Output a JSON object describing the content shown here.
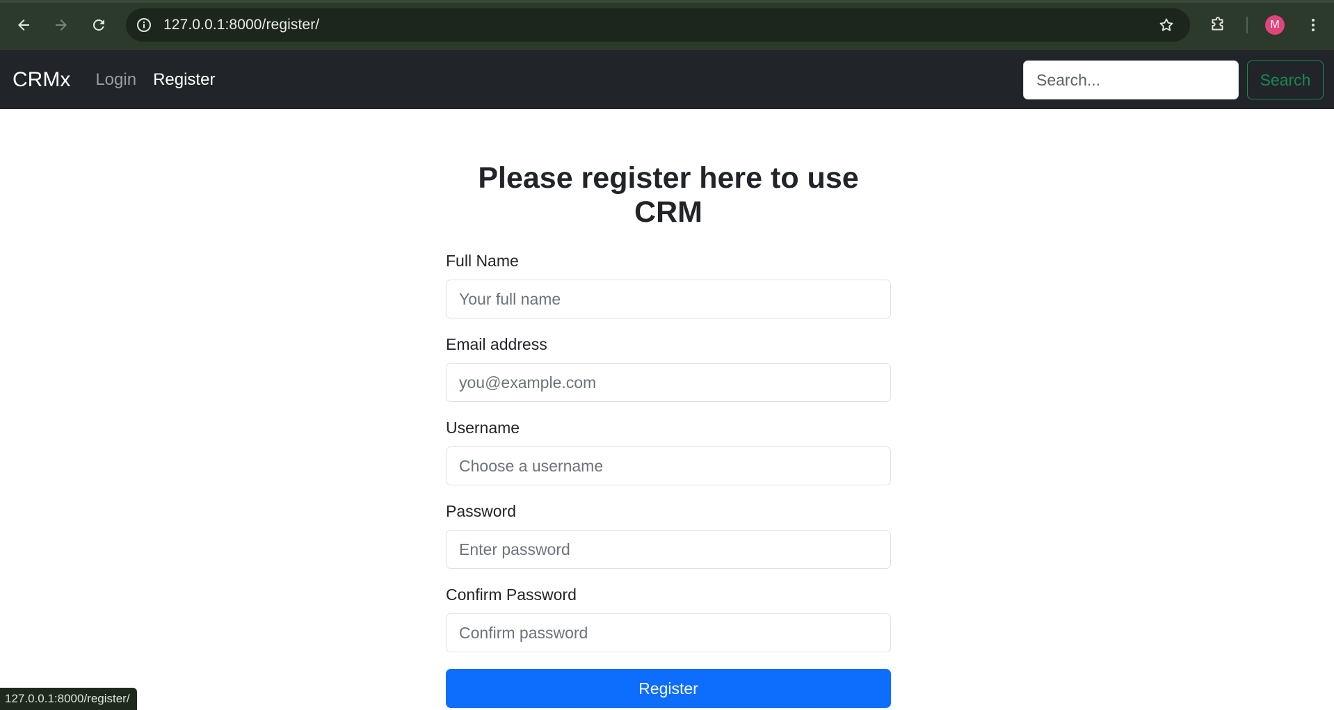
{
  "browser": {
    "url": "127.0.0.1:8000/register/",
    "profile_initial": "M",
    "status_url": "127.0.0.1:8000/register/"
  },
  "navbar": {
    "brand": "CRMx",
    "links": [
      {
        "label": "Login",
        "active": false
      },
      {
        "label": "Register",
        "active": true
      }
    ],
    "search_placeholder": "Search...",
    "search_button": "Search"
  },
  "form": {
    "title": "Please register here to use CRM",
    "fields": [
      {
        "label": "Full Name",
        "placeholder": "Your full name"
      },
      {
        "label": "Email address",
        "placeholder": "you@example.com"
      },
      {
        "label": "Username",
        "placeholder": "Choose a username"
      },
      {
        "label": "Password",
        "placeholder": "Enter password"
      },
      {
        "label": "Confirm Password",
        "placeholder": "Confirm password"
      }
    ],
    "submit_label": "Register"
  },
  "colors": {
    "navbar_bg": "#212529",
    "primary": "#0d6efd",
    "success": "#198754",
    "browser_bg": "#2b3a2a"
  }
}
